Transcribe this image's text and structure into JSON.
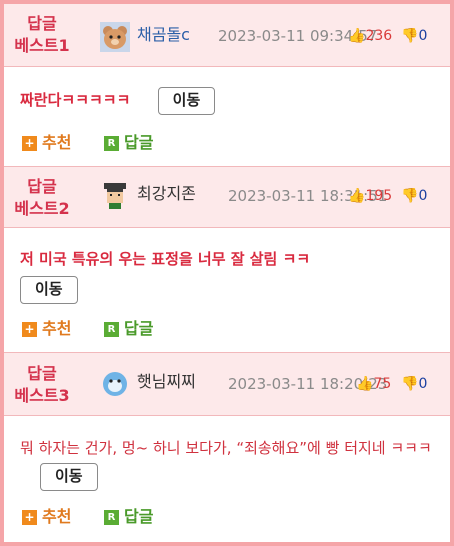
{
  "entries": [
    {
      "title_line1": "답글",
      "title_line2": "베스트1",
      "nickname": "채곰돌c",
      "date": "2023-03-11 09:34:57",
      "up": "236",
      "down": "0",
      "content": "짜란다ㅋㅋㅋㅋㅋ",
      "move_label": "이동",
      "recommend_label": "추천",
      "reply_label": "답글"
    },
    {
      "title_line1": "답글",
      "title_line2": "베스트2",
      "nickname": "최강지존",
      "date": "2023-03-11 18:31:51",
      "up": "195",
      "down": "0",
      "content": "저 미국 특유의 우는 표정을 너무 잘 살림 ㅋㅋ",
      "move_label": "이동",
      "recommend_label": "추천",
      "reply_label": "답글"
    },
    {
      "title_line1": "답글",
      "title_line2": "베스트3",
      "nickname": "햇님찌찌",
      "date": "2023-03-11 18:20:23",
      "up": "75",
      "down": "0",
      "content": "뭐 하자는 건가, 멍~ 하니 보다가, “죄송해요”에 빵 터지네 ㅋㅋㅋ",
      "move_label": "이동",
      "recommend_label": "추천",
      "reply_label": "답글"
    }
  ],
  "icons": {
    "recommend": "plus-icon",
    "reply": "reply-r-icon",
    "up": "thumbs-up-icon",
    "down": "thumbs-down-icon"
  },
  "colors": {
    "border": "#f5a5a8",
    "header_bg": "#fde9ea",
    "title": "#d4324c",
    "content": "#d92a3f",
    "recommend": "#f08a1c",
    "reply": "#5aac34"
  }
}
